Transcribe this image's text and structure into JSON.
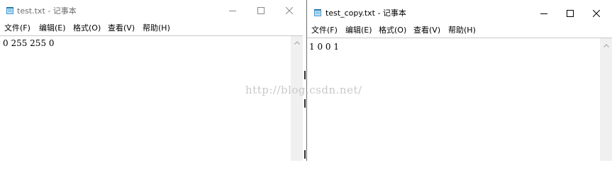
{
  "left_window": {
    "title": "test.txt - 记事本",
    "menu": [
      "文件(F)",
      "编辑(E)",
      "格式(O)",
      "查看(V)",
      "帮助(H)"
    ],
    "content": "0 255 255 0"
  },
  "right_window": {
    "title": "test_copy.txt - 记事本",
    "menu": [
      "文件(F)",
      "编辑(E)",
      "格式(O)",
      "查看(V)",
      "帮助(H)"
    ],
    "content": "1 0 0 1"
  },
  "watermark": "http://blog.csdn.net/",
  "icons": {
    "app": "notepad-icon",
    "minimize": "minimize-icon",
    "maximize": "maximize-icon",
    "close": "close-icon",
    "scroll_up": "chevron-up-icon"
  },
  "colors": {
    "inactive_title": "#6d6d6d",
    "active_title": "#000000",
    "scrollbar": "#f0f0f0",
    "watermark": "#c9c9c9"
  }
}
